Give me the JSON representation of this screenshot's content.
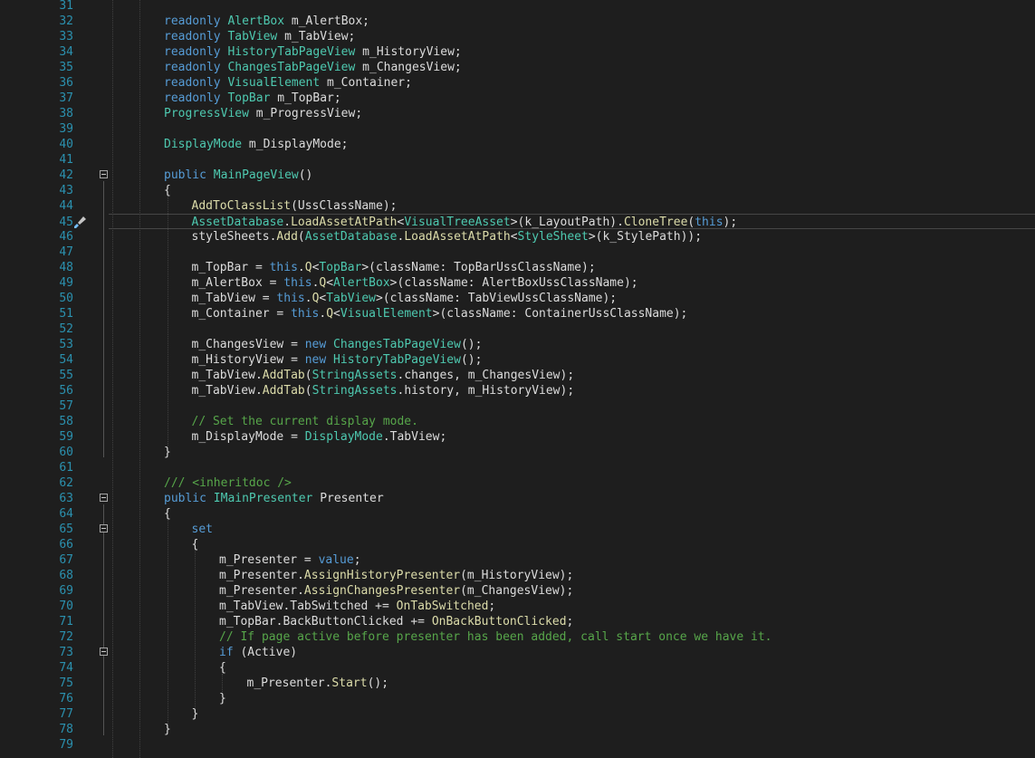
{
  "editor": {
    "lines": [
      {
        "n": "31",
        "tokens": []
      },
      {
        "n": "32",
        "tokens": [
          [
            "kw",
            "readonly"
          ],
          [
            "plain",
            " "
          ],
          [
            "type",
            "AlertBox"
          ],
          [
            "plain",
            " m_AlertBox;"
          ]
        ]
      },
      {
        "n": "33",
        "tokens": [
          [
            "kw",
            "readonly"
          ],
          [
            "plain",
            " "
          ],
          [
            "type",
            "TabView"
          ],
          [
            "plain",
            " m_TabView;"
          ]
        ]
      },
      {
        "n": "34",
        "tokens": [
          [
            "kw",
            "readonly"
          ],
          [
            "plain",
            " "
          ],
          [
            "type",
            "HistoryTabPageView"
          ],
          [
            "plain",
            " m_HistoryView;"
          ]
        ]
      },
      {
        "n": "35",
        "tokens": [
          [
            "kw",
            "readonly"
          ],
          [
            "plain",
            " "
          ],
          [
            "type",
            "ChangesTabPageView"
          ],
          [
            "plain",
            " m_ChangesView;"
          ]
        ]
      },
      {
        "n": "36",
        "tokens": [
          [
            "kw",
            "readonly"
          ],
          [
            "plain",
            " "
          ],
          [
            "type",
            "VisualElement"
          ],
          [
            "plain",
            " m_Container;"
          ]
        ]
      },
      {
        "n": "37",
        "tokens": [
          [
            "kw",
            "readonly"
          ],
          [
            "plain",
            " "
          ],
          [
            "type",
            "TopBar"
          ],
          [
            "plain",
            " m_TopBar;"
          ]
        ]
      },
      {
        "n": "38",
        "tokens": [
          [
            "type",
            "ProgressView"
          ],
          [
            "plain",
            " m_ProgressView;"
          ]
        ]
      },
      {
        "n": "39",
        "tokens": []
      },
      {
        "n": "40",
        "tokens": [
          [
            "type",
            "DisplayMode"
          ],
          [
            "plain",
            " m_DisplayMode;"
          ]
        ]
      },
      {
        "n": "41",
        "tokens": []
      },
      {
        "n": "42",
        "fold": true,
        "tokens": [
          [
            "kw",
            "public"
          ],
          [
            "plain",
            " "
          ],
          [
            "type",
            "MainPageView"
          ],
          [
            "plain",
            "()"
          ]
        ]
      },
      {
        "n": "43",
        "tokens": [
          [
            "plain",
            "{"
          ]
        ]
      },
      {
        "n": "44",
        "indent": 1,
        "tokens": [
          [
            "method",
            "AddToClassList"
          ],
          [
            "plain",
            "(UssClassName);"
          ]
        ]
      },
      {
        "n": "45",
        "indent": 1,
        "current": true,
        "icon": true,
        "tokens": [
          [
            "type",
            "AssetDatabase"
          ],
          [
            "plain",
            "."
          ],
          [
            "method",
            "LoadAssetAtPath"
          ],
          [
            "plain",
            "<"
          ],
          [
            "type",
            "VisualTreeAsset"
          ],
          [
            "plain",
            ">(k_LayoutPath)."
          ],
          [
            "method",
            "CloneTree"
          ],
          [
            "plain",
            "("
          ],
          [
            "kw",
            "this"
          ],
          [
            "plain",
            ");"
          ]
        ]
      },
      {
        "n": "46",
        "indent": 1,
        "tokens": [
          [
            "plain",
            "styleSheets."
          ],
          [
            "method",
            "Add"
          ],
          [
            "plain",
            "("
          ],
          [
            "type",
            "AssetDatabase"
          ],
          [
            "plain",
            "."
          ],
          [
            "method",
            "LoadAssetAtPath"
          ],
          [
            "plain",
            "<"
          ],
          [
            "type",
            "StyleSheet"
          ],
          [
            "plain",
            ">(k_StylePath));"
          ]
        ]
      },
      {
        "n": "47",
        "tokens": []
      },
      {
        "n": "48",
        "indent": 1,
        "tokens": [
          [
            "plain",
            "m_TopBar = "
          ],
          [
            "kw",
            "this"
          ],
          [
            "plain",
            "."
          ],
          [
            "method",
            "Q"
          ],
          [
            "plain",
            "<"
          ],
          [
            "type",
            "TopBar"
          ],
          [
            "plain",
            ">(className: TopBarUssClassName);"
          ]
        ]
      },
      {
        "n": "49",
        "indent": 1,
        "tokens": [
          [
            "plain",
            "m_AlertBox = "
          ],
          [
            "kw",
            "this"
          ],
          [
            "plain",
            "."
          ],
          [
            "method",
            "Q"
          ],
          [
            "plain",
            "<"
          ],
          [
            "type",
            "AlertBox"
          ],
          [
            "plain",
            ">(className: AlertBoxUssClassName);"
          ]
        ]
      },
      {
        "n": "50",
        "indent": 1,
        "tokens": [
          [
            "plain",
            "m_TabView = "
          ],
          [
            "kw",
            "this"
          ],
          [
            "plain",
            "."
          ],
          [
            "method",
            "Q"
          ],
          [
            "plain",
            "<"
          ],
          [
            "type",
            "TabView"
          ],
          [
            "plain",
            ">(className: TabViewUssClassName);"
          ]
        ]
      },
      {
        "n": "51",
        "indent": 1,
        "tokens": [
          [
            "plain",
            "m_Container = "
          ],
          [
            "kw",
            "this"
          ],
          [
            "plain",
            "."
          ],
          [
            "method",
            "Q"
          ],
          [
            "plain",
            "<"
          ],
          [
            "type",
            "VisualElement"
          ],
          [
            "plain",
            ">(className: ContainerUssClassName);"
          ]
        ]
      },
      {
        "n": "52",
        "tokens": []
      },
      {
        "n": "53",
        "indent": 1,
        "tokens": [
          [
            "plain",
            "m_ChangesView = "
          ],
          [
            "kw",
            "new"
          ],
          [
            "plain",
            " "
          ],
          [
            "type",
            "ChangesTabPageView"
          ],
          [
            "plain",
            "();"
          ]
        ]
      },
      {
        "n": "54",
        "indent": 1,
        "tokens": [
          [
            "plain",
            "m_HistoryView = "
          ],
          [
            "kw",
            "new"
          ],
          [
            "plain",
            " "
          ],
          [
            "type",
            "HistoryTabPageView"
          ],
          [
            "plain",
            "();"
          ]
        ]
      },
      {
        "n": "55",
        "indent": 1,
        "tokens": [
          [
            "plain",
            "m_TabView."
          ],
          [
            "method",
            "AddTab"
          ],
          [
            "plain",
            "("
          ],
          [
            "type",
            "StringAssets"
          ],
          [
            "plain",
            ".changes, m_ChangesView);"
          ]
        ]
      },
      {
        "n": "56",
        "indent": 1,
        "tokens": [
          [
            "plain",
            "m_TabView."
          ],
          [
            "method",
            "AddTab"
          ],
          [
            "plain",
            "("
          ],
          [
            "type",
            "StringAssets"
          ],
          [
            "plain",
            ".history, m_HistoryView);"
          ]
        ]
      },
      {
        "n": "57",
        "tokens": []
      },
      {
        "n": "58",
        "indent": 1,
        "tokens": [
          [
            "comment",
            "// Set the current display mode."
          ]
        ]
      },
      {
        "n": "59",
        "indent": 1,
        "tokens": [
          [
            "plain",
            "m_DisplayMode = "
          ],
          [
            "type",
            "DisplayMode"
          ],
          [
            "plain",
            ".TabView;"
          ]
        ]
      },
      {
        "n": "60",
        "tokens": [
          [
            "plain",
            "}"
          ]
        ]
      },
      {
        "n": "61",
        "tokens": []
      },
      {
        "n": "62",
        "tokens": [
          [
            "comment",
            "/// <inheritdoc />"
          ]
        ]
      },
      {
        "n": "63",
        "fold": true,
        "tokens": [
          [
            "kw",
            "public"
          ],
          [
            "plain",
            " "
          ],
          [
            "type",
            "IMainPresenter"
          ],
          [
            "plain",
            " Presenter"
          ]
        ]
      },
      {
        "n": "64",
        "tokens": [
          [
            "plain",
            "{"
          ]
        ]
      },
      {
        "n": "65",
        "indent": 1,
        "fold": true,
        "tokens": [
          [
            "kw",
            "set"
          ]
        ]
      },
      {
        "n": "66",
        "indent": 1,
        "tokens": [
          [
            "plain",
            "{"
          ]
        ]
      },
      {
        "n": "67",
        "indent": 2,
        "tokens": [
          [
            "plain",
            "m_Presenter = "
          ],
          [
            "kw",
            "value"
          ],
          [
            "plain",
            ";"
          ]
        ]
      },
      {
        "n": "68",
        "indent": 2,
        "tokens": [
          [
            "plain",
            "m_Presenter."
          ],
          [
            "method",
            "AssignHistoryPresenter"
          ],
          [
            "plain",
            "(m_HistoryView);"
          ]
        ]
      },
      {
        "n": "69",
        "indent": 2,
        "tokens": [
          [
            "plain",
            "m_Presenter."
          ],
          [
            "method",
            "AssignChangesPresenter"
          ],
          [
            "plain",
            "(m_ChangesView);"
          ]
        ]
      },
      {
        "n": "70",
        "indent": 2,
        "tokens": [
          [
            "plain",
            "m_TabView.TabSwitched += "
          ],
          [
            "method",
            "OnTabSwitched"
          ],
          [
            "plain",
            ";"
          ]
        ]
      },
      {
        "n": "71",
        "indent": 2,
        "tokens": [
          [
            "plain",
            "m_TopBar.BackButtonClicked += "
          ],
          [
            "method",
            "OnBackButtonClicked"
          ],
          [
            "plain",
            ";"
          ]
        ]
      },
      {
        "n": "72",
        "indent": 2,
        "tokens": [
          [
            "comment",
            "// If page active before presenter has been added, call start once we have it."
          ]
        ]
      },
      {
        "n": "73",
        "indent": 2,
        "fold": true,
        "tokens": [
          [
            "kw",
            "if"
          ],
          [
            "plain",
            " (Active)"
          ]
        ]
      },
      {
        "n": "74",
        "indent": 2,
        "tokens": [
          [
            "plain",
            "{"
          ]
        ]
      },
      {
        "n": "75",
        "indent": 3,
        "tokens": [
          [
            "plain",
            "m_Presenter."
          ],
          [
            "method",
            "Start"
          ],
          [
            "plain",
            "();"
          ]
        ]
      },
      {
        "n": "76",
        "indent": 2,
        "tokens": [
          [
            "plain",
            "}"
          ]
        ]
      },
      {
        "n": "77",
        "indent": 1,
        "tokens": [
          [
            "plain",
            "}"
          ]
        ]
      },
      {
        "n": "78",
        "tokens": [
          [
            "plain",
            "}"
          ]
        ]
      },
      {
        "n": "79",
        "tokens": []
      }
    ]
  },
  "colors": {
    "background": "#1e1e1e",
    "line_number": "#2b91af",
    "keyword": "#569cd6",
    "type": "#4ec9b0",
    "method": "#dcdcaa",
    "comment": "#57a64a",
    "plain": "#dcdcdc"
  },
  "icons": {
    "line_45_gutter": "quick-action-brush-icon",
    "fold": "collapse-minus-icon"
  }
}
